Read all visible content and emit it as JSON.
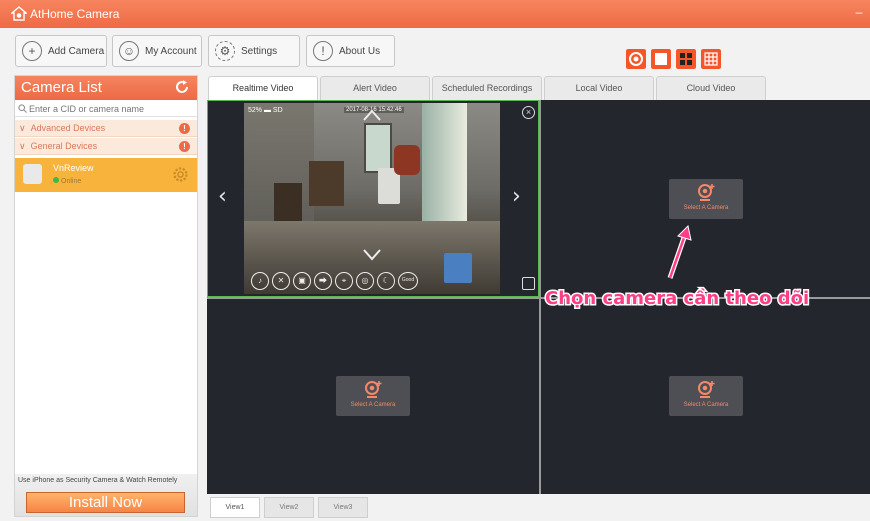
{
  "window": {
    "title": "AtHome Camera",
    "minimize_glyph": "–"
  },
  "toolbar": {
    "add_camera": "Add Camera",
    "my_account": "My Account",
    "settings": "Settings",
    "about_us": "About Us"
  },
  "layout_buttons": [
    {
      "icon": "layout-single-ring-icon",
      "color": "#f4562a"
    },
    {
      "icon": "layout-single-square-icon",
      "color": "#f4562a"
    },
    {
      "icon": "layout-four-grid-icon",
      "color": "#f4562a"
    },
    {
      "icon": "layout-nine-grid-icon",
      "color": "#f4562a"
    }
  ],
  "sidebar": {
    "title": "Camera List",
    "search_placeholder": "Enter a CID or camera name",
    "groups": [
      "Advanced Devices",
      "General Devices"
    ],
    "device": {
      "name": "VnReview",
      "status": "Online"
    },
    "ad": {
      "text": "Use iPhone as Security Camera & Watch Remotely",
      "button": "Install Now"
    }
  },
  "tabs": [
    "Realtime Video",
    "Alert Video",
    "Scheduled Recordings",
    "Local Video",
    "Cloud Video"
  ],
  "active_tab": "Realtime Video",
  "video": {
    "osd_left": "52% ▬ SD",
    "timestamp": "2017-08-16 15:42:46",
    "controls": [
      "♪",
      "✕",
      "▣",
      "⮕",
      "⌖",
      "◎",
      "☾",
      "Good"
    ]
  },
  "select_camera_label": "Select A Camera",
  "callout": "Chọn camera cần theo dõi",
  "view_tabs": [
    "View1",
    "View2",
    "View3"
  ],
  "colors": {
    "accent": "#ee6a45",
    "device_highlight": "#f7b33b",
    "video_bg": "#23262d",
    "callout": "#ff3e86"
  }
}
